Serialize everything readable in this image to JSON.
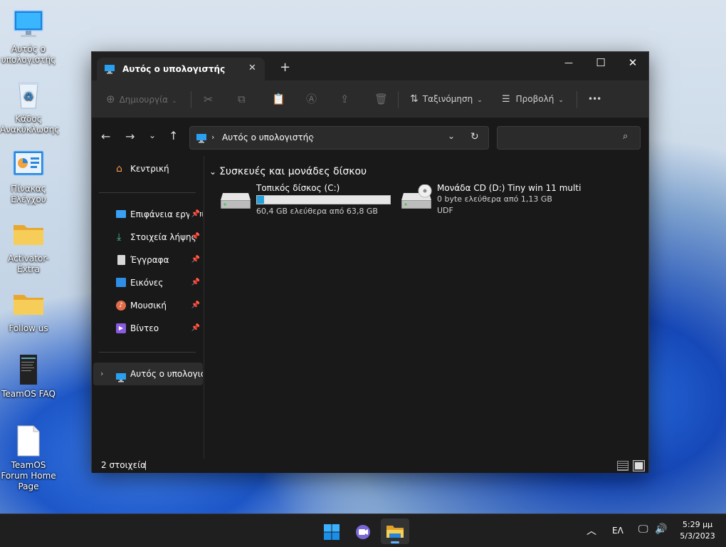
{
  "desktop": {
    "icons": [
      {
        "label": "Αυτός ο υπολογιστής",
        "icon": "monitor-icon"
      },
      {
        "label": "Κάδος Ανακύκλωσης",
        "icon": "recycle-bin-icon"
      },
      {
        "label": "Πίνακας Ελέγχου",
        "icon": "control-panel-icon"
      },
      {
        "label": "Activator-Extra",
        "icon": "folder-icon"
      },
      {
        "label": "Follow us",
        "icon": "folder-icon"
      },
      {
        "label": "TeamOS FAQ",
        "icon": "document-icon"
      },
      {
        "label": "TeamOS Forum Home Page",
        "icon": "blank-document-icon"
      }
    ]
  },
  "window": {
    "tab": {
      "title": "Αυτός ο υπολογιστής",
      "close": "✕",
      "new_tab": "+"
    },
    "controls": {
      "minimize": "—",
      "maximize": "☐",
      "close": "✕"
    },
    "toolbar": {
      "new_label": "Δημιουργία",
      "sort_label": "Ταξινόμηση",
      "view_label": "Προβολή",
      "more": "•••"
    },
    "address": {
      "path": "Αυτός ο υπολογιστής",
      "search_placeholder": ""
    },
    "sidebar": {
      "home": "Κεντρική",
      "quick_access": [
        {
          "label": "Επιφάνεια εργασίας",
          "icon": "desktop-icon",
          "color": "#3aa0f5"
        },
        {
          "label": "Στοιχεία λήψης",
          "icon": "download-icon",
          "color": "#4cc2a0"
        },
        {
          "label": "Έγγραφα",
          "icon": "document-icon",
          "color": "#d8d8d8"
        },
        {
          "label": "Εικόνες",
          "icon": "pictures-icon",
          "color": "#2f8ee8"
        },
        {
          "label": "Μουσική",
          "icon": "music-icon",
          "color": "#e06c4a"
        },
        {
          "label": "Βίντεο",
          "icon": "video-icon",
          "color": "#8a5ae0"
        }
      ],
      "this_pc": "Αυτός ο υπολογιστής"
    },
    "section_title": "Συσκευές και μονάδες δίσκου",
    "drives": [
      {
        "name": "Τοπικός δίσκος (C:)",
        "info": "60,4 GB ελεύθερα από 63,8 GB",
        "used_fraction": 0.053,
        "icon": "hard-drive-icon"
      },
      {
        "name": "Μονάδα CD (D:) Tiny win 11 multi",
        "info": "0 byte ελεύθερα από 1,13 GB",
        "fs": "UDF",
        "icon": "cd-drive-icon"
      }
    ],
    "status": {
      "count": "2 στοιχεία"
    }
  },
  "taskbar": {
    "lang": "ΕΛ",
    "time": "5:29 μμ",
    "date": "5/3/2023"
  },
  "colors": {
    "accent": "#26a0da",
    "window_bg": "#191919",
    "toolbar_bg": "#2b2b2b"
  }
}
